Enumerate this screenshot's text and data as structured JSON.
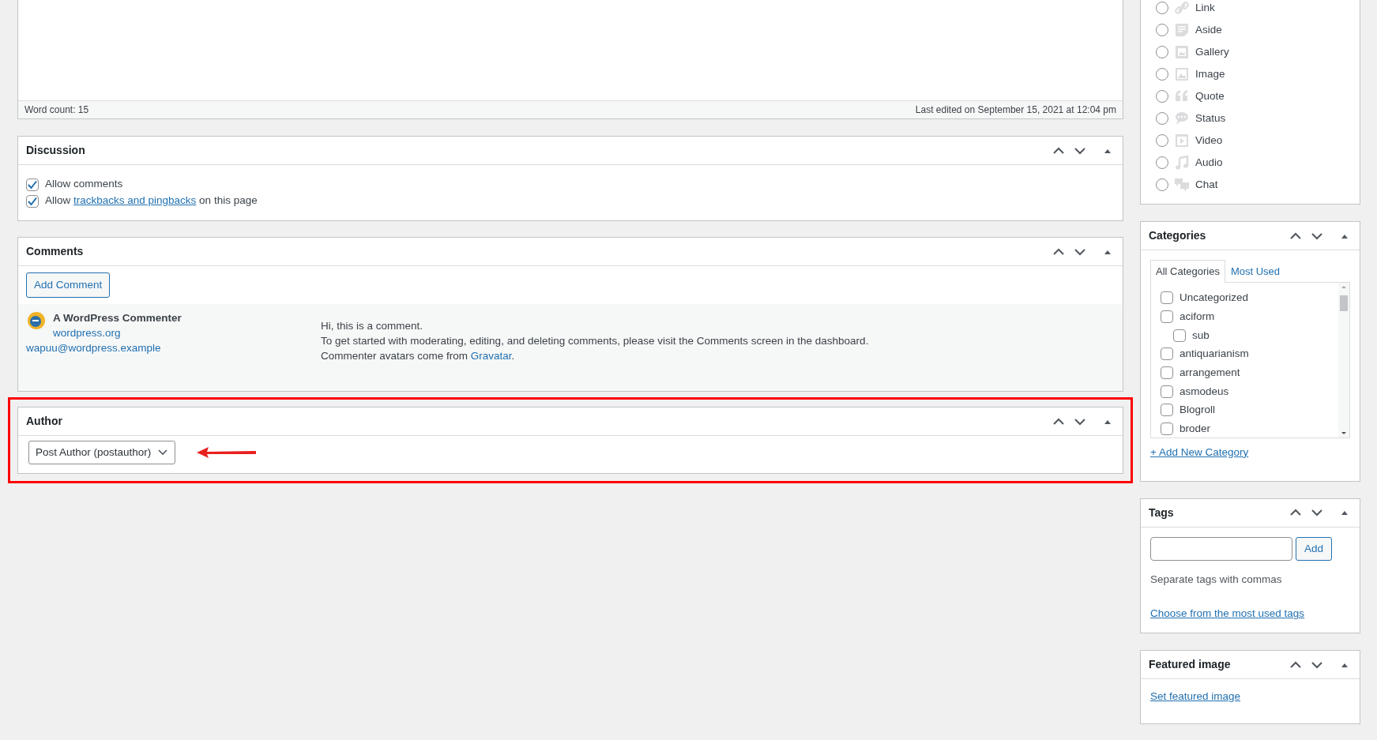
{
  "editor": {
    "word_count": "Word count: 15",
    "last_edited": "Last edited on September 15, 2021 at 12:04 pm"
  },
  "discussion": {
    "title": "Discussion",
    "options": [
      {
        "text": "Allow comments",
        "checked": true
      },
      {
        "text": "Allow ",
        "link": "trackbacks and pingbacks",
        "after": " on this page",
        "checked": true
      }
    ]
  },
  "comments": {
    "title": "Comments",
    "add_button": "Add Comment",
    "items": [
      {
        "author": "A WordPress Commenter",
        "url": "wordpress.org",
        "email": "wapuu@wordpress.example",
        "lines": [
          {
            "text": "Hi, this is a comment."
          },
          {
            "text": "To get started with moderating, editing, and deleting comments, please visit the Comments screen in the dashboard."
          },
          {
            "text": "Commenter avatars come from ",
            "link": "Gravatar",
            "after": "."
          }
        ]
      }
    ]
  },
  "author": {
    "title": "Author",
    "value": "Post Author (postauthor)",
    "highlighted": true
  },
  "format": {
    "options": [
      {
        "label": "Link",
        "selected": false
      },
      {
        "label": "Aside",
        "selected": false
      },
      {
        "label": "Gallery",
        "selected": false
      },
      {
        "label": "Image",
        "selected": false
      },
      {
        "label": "Quote",
        "selected": false
      },
      {
        "label": "Status",
        "selected": false
      },
      {
        "label": "Video",
        "selected": false
      },
      {
        "label": "Audio",
        "selected": false
      },
      {
        "label": "Chat",
        "selected": false
      }
    ]
  },
  "categories": {
    "title": "Categories",
    "tabs": [
      {
        "label": "All Categories",
        "selected": true
      },
      {
        "label": "Most Used",
        "selected": false
      }
    ],
    "items": [
      {
        "label": "Uncategorized",
        "checked": false
      },
      {
        "label": "aciform",
        "checked": false,
        "children": [
          {
            "label": "sub",
            "checked": false
          }
        ]
      },
      {
        "label": "antiquarianism",
        "checked": false
      },
      {
        "label": "arrangement",
        "checked": false
      },
      {
        "label": "asmodeus",
        "checked": false
      },
      {
        "label": "Blogroll",
        "checked": false
      },
      {
        "label": "broder",
        "checked": false
      }
    ],
    "add_link": "+ Add New Category"
  },
  "tags": {
    "title": "Tags",
    "button": "Add",
    "hint": "Separate tags with commas",
    "link": "Choose from the most used tags"
  },
  "featured_image": {
    "title": "Featured image",
    "link": "Set featured image"
  }
}
